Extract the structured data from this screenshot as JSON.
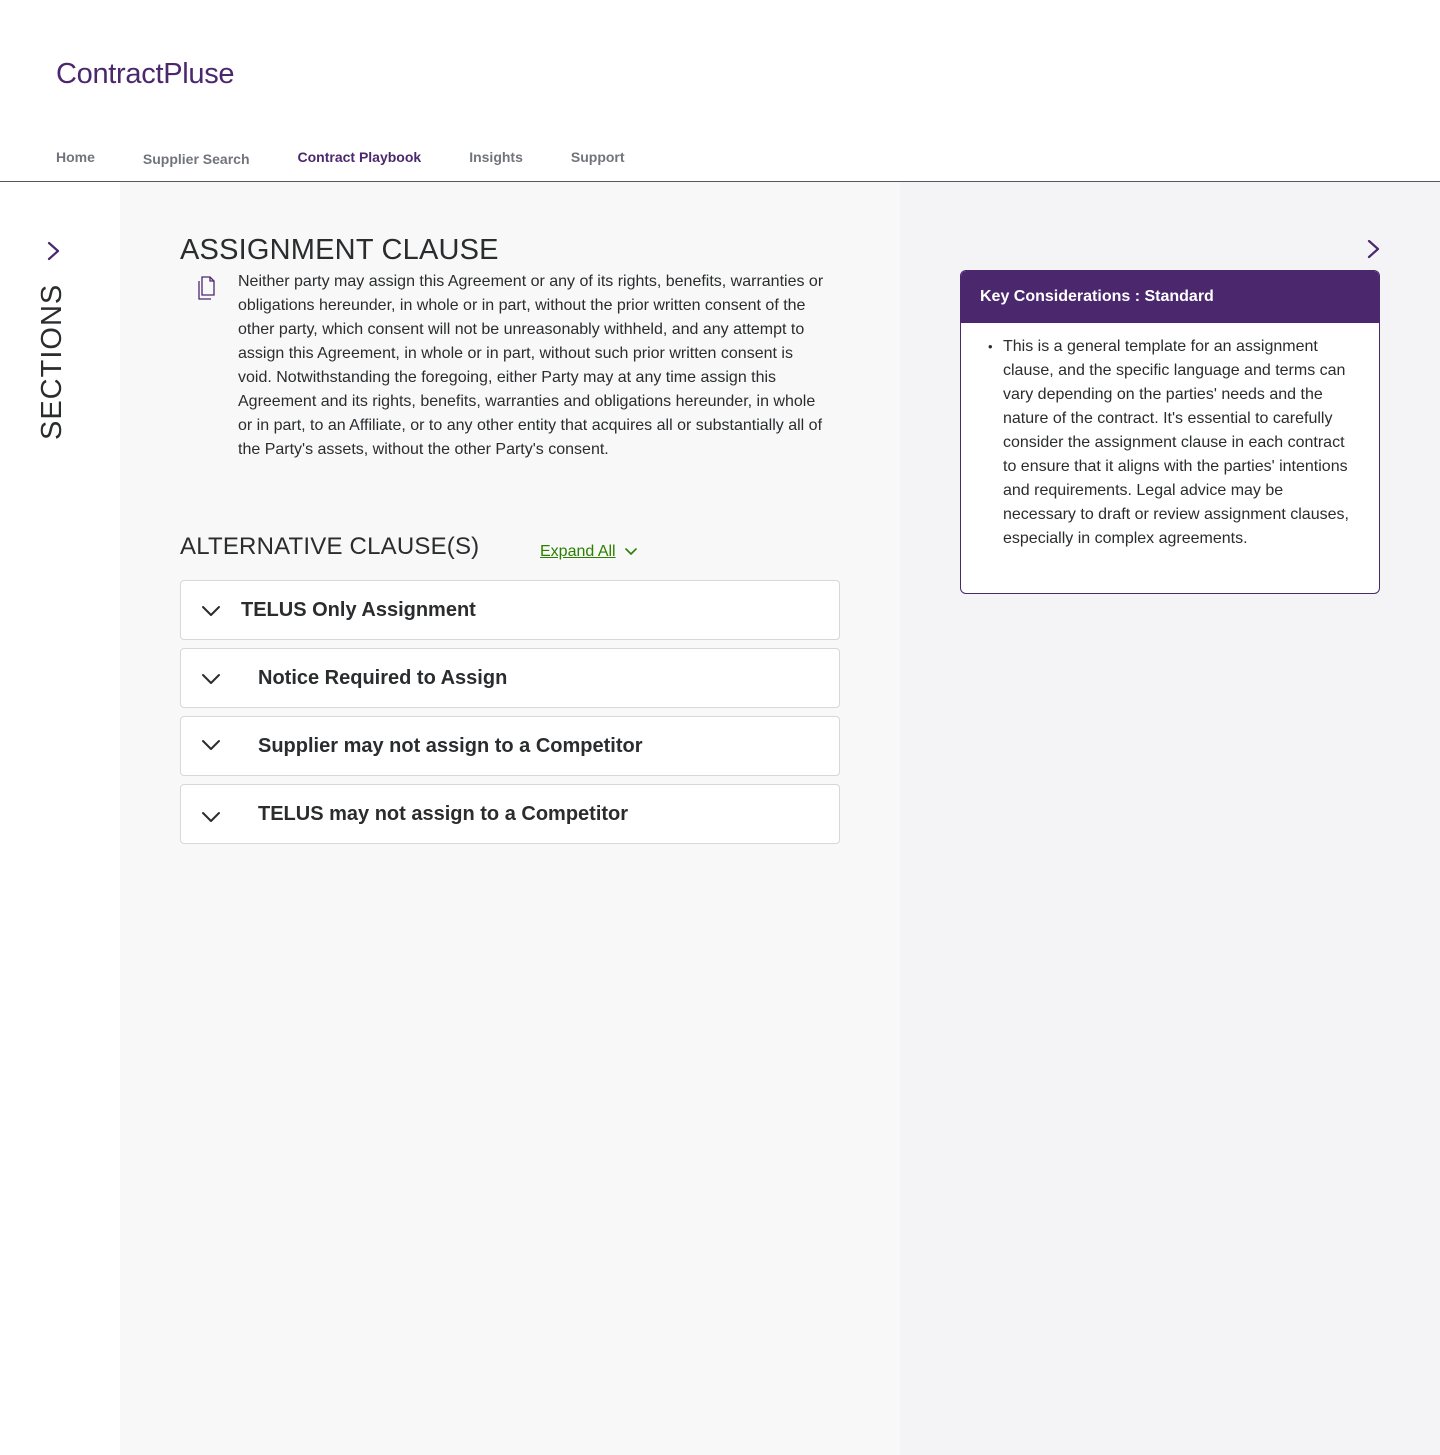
{
  "app": {
    "logo": "ContractPluse"
  },
  "nav": {
    "items": [
      {
        "label": "Home"
      },
      {
        "label": "Supplier Search"
      },
      {
        "label": "Contract Playbook"
      },
      {
        "label": "Insights"
      },
      {
        "label": "Support"
      }
    ],
    "active": "Contract Playbook"
  },
  "sidebar": {
    "label": "SECTIONS"
  },
  "clause": {
    "title": "ASSIGNMENT CLAUSE",
    "text": "Neither party may assign this Agreement or any of its rights, benefits, warranties or obligations hereunder, in whole or in part, without the prior written consent of the other party, which consent will not be unreasonably withheld, and any attempt to assign this Agreement, in whole or in part, without such prior written consent is void. Notwithstanding the foregoing, either Party may at any time assign this Agreement and its rights, benefits, warranties and obligations hereunder, in whole or in part, to an Affiliate, or to any other entity that acquires all or substantially all of the Party's assets, without the other Party's consent."
  },
  "alternatives": {
    "title": "ALTERNATIVE CLAUSE(S)",
    "expand_all_label": "Expand All",
    "items": [
      {
        "label": "TELUS Only Assignment"
      },
      {
        "label": "Notice Required to Assign"
      },
      {
        "label": "Supplier may not assign to a Competitor"
      },
      {
        "label": "TELUS may not assign to a Competitor"
      }
    ]
  },
  "key_considerations": {
    "title": "Key Considerations : Standard",
    "bullets": [
      "This is a general template for an assignment clause, and the specific language and terms can vary depending on the parties' needs and the nature of the contract. It's essential to carefully consider the assignment clause in each contract to ensure that it aligns with the parties' intentions and requirements. Legal advice may be necessary to draft or review assignment clauses, especially in complex agreements."
    ]
  },
  "icons": {
    "sidebar_toggle": "chevron-right-icon",
    "copy": "copy-icon",
    "expand": "chevron-down-icon",
    "panel_toggle": "chevron-right-icon"
  },
  "colors": {
    "brand_purple": "#4b286d",
    "link_green": "#2b8000",
    "text": "#2a2c2e",
    "nav_inactive": "#71757b"
  }
}
